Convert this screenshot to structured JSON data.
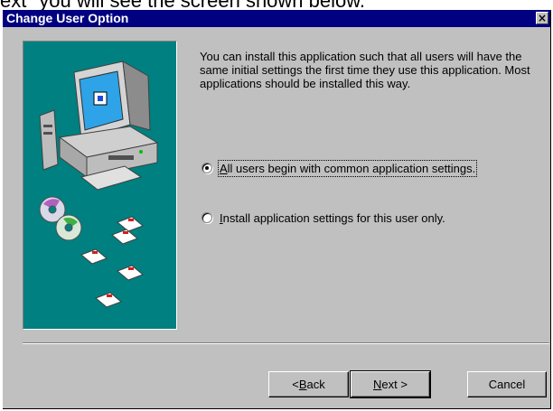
{
  "background_caption": "ext\" you will see the screen shown below.",
  "dialog": {
    "title": "Change User Option",
    "close_glyph": "×",
    "intro_text": "You can install this application such that all users will have the same initial settings the first time they use this application.  Most applications should be installed this way.",
    "options": [
      {
        "mnemonic": "A",
        "rest": "ll users begin with common application settings.",
        "selected": true
      },
      {
        "mnemonic": "I",
        "rest": "nstall application settings for this user only.",
        "selected": false
      }
    ],
    "buttons": {
      "back": {
        "prefix": "< ",
        "mnemonic": "B",
        "rest": "ack"
      },
      "next": {
        "mnemonic": "N",
        "rest": "ext >"
      },
      "cancel": {
        "label": "Cancel"
      }
    },
    "colors": {
      "title_bar": "#000080",
      "face": "#c0c0c0",
      "art_background": "#008080"
    }
  }
}
